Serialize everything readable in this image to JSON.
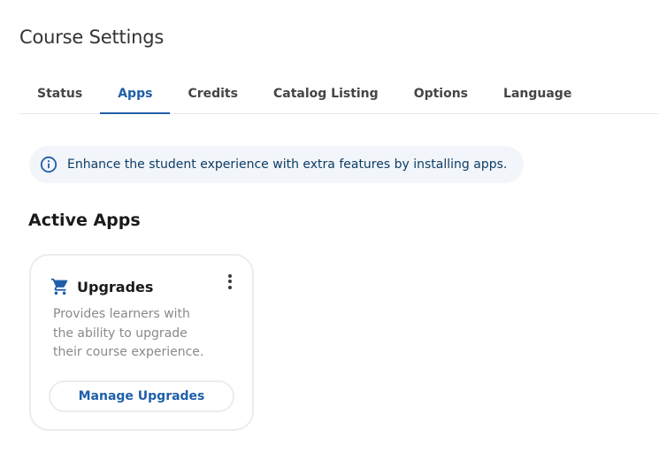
{
  "page": {
    "title": "Course Settings"
  },
  "tabs": [
    {
      "label": "Status",
      "active": false
    },
    {
      "label": "Apps",
      "active": true
    },
    {
      "label": "Credits",
      "active": false
    },
    {
      "label": "Catalog Listing",
      "active": false
    },
    {
      "label": "Options",
      "active": false
    },
    {
      "label": "Language",
      "active": false
    }
  ],
  "info_banner": {
    "icon": "info-icon",
    "text": "Enhance the student experience with extra features by installing apps."
  },
  "active_apps": {
    "heading": "Active Apps",
    "apps": [
      {
        "icon": "shopping-cart-icon",
        "name": "Upgrades",
        "description": "Provides learners with the ability to upgrade their course experience.",
        "action_label": "Manage Upgrades",
        "menu_icon": "more-vertical-icon"
      }
    ]
  },
  "colors": {
    "accent": "#1f5fa8",
    "banner_bg": "#f2f5f9",
    "banner_text": "#0d3d66",
    "muted_text": "#8a8a8a",
    "card_border": "#ececec"
  }
}
